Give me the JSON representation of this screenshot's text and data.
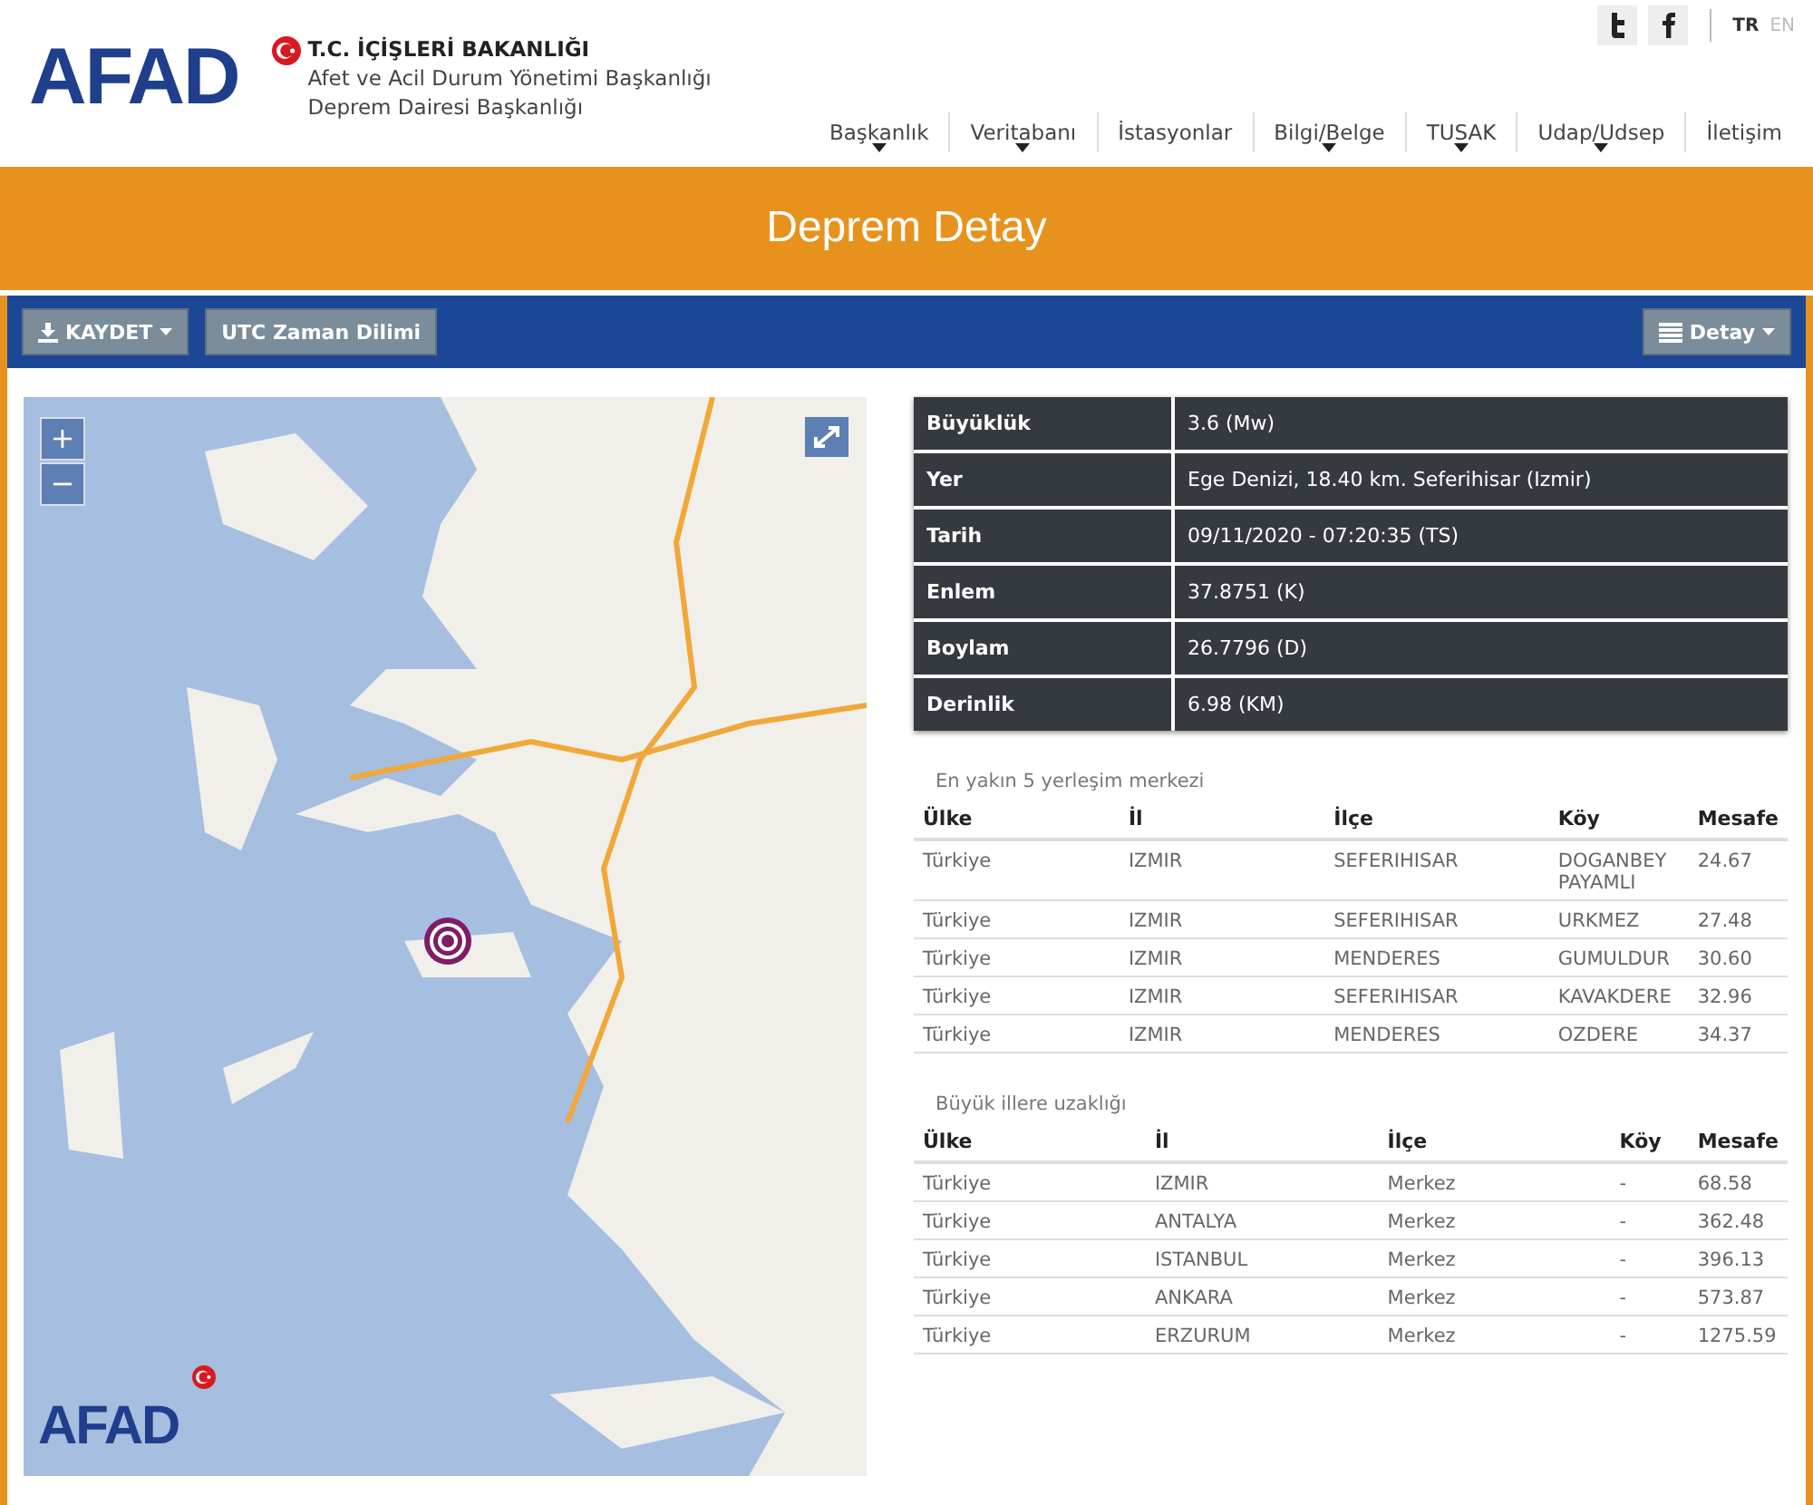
{
  "header": {
    "logo": "AFAD",
    "ministry": "T.C. İÇİŞLERİ BAKANLIĞI",
    "agency": "Afet ve Acil Durum Yönetimi Başkanlığı",
    "department": "Deprem Dairesi Başkanlığı",
    "languages": [
      {
        "label": "TR",
        "selected": true
      },
      {
        "label": "EN",
        "selected": false
      }
    ],
    "nav": [
      {
        "label": "Başkanlık",
        "has_menu": true
      },
      {
        "label": "Veritabanı",
        "has_menu": true
      },
      {
        "label": "İstasyonlar",
        "has_menu": false
      },
      {
        "label": "Bilgi/Belge",
        "has_menu": true
      },
      {
        "label": "TUSAK",
        "has_menu": true
      },
      {
        "label": "Udap/Udsep",
        "has_menu": true
      },
      {
        "label": "İletişim",
        "has_menu": false
      }
    ]
  },
  "page_title": "Deprem Detay",
  "toolbar": {
    "save": "KAYDET",
    "utc": "UTC Zaman Dilimi",
    "detail": "Detay"
  },
  "map": {
    "zoom_in": "+",
    "zoom_out": "−",
    "logo": "AFAD"
  },
  "details": [
    {
      "label": "Büyüklük",
      "value": "3.6 (Mw)"
    },
    {
      "label": "Yer",
      "value": "Ege Denizi, 18.40 km. Seferihisar (Izmir)"
    },
    {
      "label": "Tarih",
      "value": "09/11/2020 - 07:20:35 (TS)"
    },
    {
      "label": "Enlem",
      "value": "37.8751 (K)"
    },
    {
      "label": "Boylam",
      "value": "26.7796 (D)"
    },
    {
      "label": "Derinlik",
      "value": "6.98 (KM)"
    }
  ],
  "nearest": {
    "title": "En yakın 5 yerleşim merkezi",
    "columns": [
      "Ülke",
      "İl",
      "İlçe",
      "Köy",
      "Mesafe"
    ],
    "rows": [
      [
        "Türkiye",
        "IZMIR",
        "SEFERIHISAR",
        "DOGANBEY PAYAMLI",
        "24.67"
      ],
      [
        "Türkiye",
        "IZMIR",
        "SEFERIHISAR",
        "URKMEZ",
        "27.48"
      ],
      [
        "Türkiye",
        "IZMIR",
        "MENDERES",
        "GUMULDUR",
        "30.60"
      ],
      [
        "Türkiye",
        "IZMIR",
        "SEFERIHISAR",
        "KAVAKDERE",
        "32.96"
      ],
      [
        "Türkiye",
        "IZMIR",
        "MENDERES",
        "OZDERE",
        "34.37"
      ]
    ]
  },
  "cities": {
    "title": "Büyük illere uzaklığı",
    "columns": [
      "Ülke",
      "İl",
      "İlçe",
      "Köy",
      "Mesafe"
    ],
    "rows": [
      [
        "Türkiye",
        "IZMIR",
        "Merkez",
        "-",
        "68.58"
      ],
      [
        "Türkiye",
        "ANTALYA",
        "Merkez",
        "-",
        "362.48"
      ],
      [
        "Türkiye",
        "ISTANBUL",
        "Merkez",
        "-",
        "396.13"
      ],
      [
        "Türkiye",
        "ANKARA",
        "Merkez",
        "-",
        "573.87"
      ],
      [
        "Türkiye",
        "ERZURUM",
        "Merkez",
        "-",
        "1275.59"
      ]
    ]
  }
}
